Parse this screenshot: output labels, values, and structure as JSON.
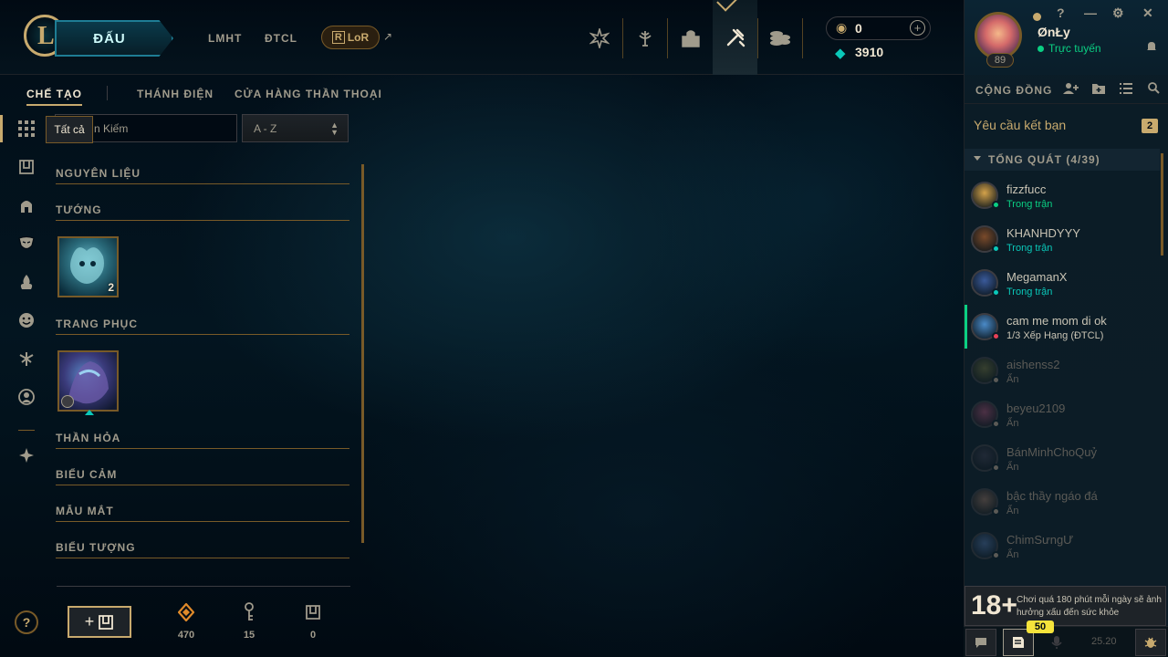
{
  "topnav": {
    "logo_letter": "L",
    "play_label": "ĐẤU",
    "links": [
      "LMHT",
      "ĐTCL"
    ],
    "lor_label": "LoR",
    "lor_arrow": "↗",
    "icons": [
      "clash-icon",
      "trophy-icon",
      "collection-icon",
      "loot-icon",
      "store-icon"
    ],
    "rp_value": "0",
    "rp_plus": "+",
    "be_value": "3910"
  },
  "profile": {
    "name": "ØnŁy",
    "status": "Trực tuyến",
    "level": "89",
    "controls": [
      "?",
      "—",
      "⚙",
      "✕"
    ]
  },
  "social": {
    "title": "CỘNG ĐỒNG",
    "friend_requests_label": "Yêu cầu kết bạn",
    "friend_requests_count": "2",
    "group_label": "TỔNG QUÁT (4/39)",
    "friends": [
      {
        "name": "fizzfucc",
        "status": "Trong trận",
        "status_color": "#0acf83",
        "dot": "#0acf83",
        "avatar": "#d4a24a"
      },
      {
        "name": "KHANHDYYY",
        "status": "Trong trận",
        "status_color": "#0ac8b9",
        "dot": "#0ac8b9",
        "avatar": "#7a4a2a"
      },
      {
        "name": "MegamanX",
        "status": "Trong trận",
        "status_color": "#0ac8b9",
        "dot": "#0ac8b9",
        "avatar": "#3a5a9a"
      },
      {
        "name": "cam me mom di ok",
        "status": "1/3 Xếp Hạng (ĐTCL)",
        "status_color": "#c8c3b4",
        "dot": "#e84057",
        "avatar": "#4a8ac8"
      },
      {
        "name": "aishenss2",
        "status": "Ẩn",
        "status_color": "#5b5a56",
        "dot": "#5b5a56",
        "avatar": "#6a6a3a"
      },
      {
        "name": "beyeu2109",
        "status": "Ẩn",
        "status_color": "#5b5a56",
        "dot": "#5b5a56",
        "avatar": "#9a4a6a"
      },
      {
        "name": "BánMinhChoQuỷ",
        "status": "Ẩn",
        "status_color": "#5b5a56",
        "dot": "#5b5a56",
        "avatar": "#3a3a4a"
      },
      {
        "name": "bậc thầy ngáo đá",
        "status": "Ẩn",
        "status_color": "#5b5a56",
        "dot": "#5b5a56",
        "avatar": "#8a6a5a"
      },
      {
        "name": "ChimSưngƯ",
        "status": "Ẩn",
        "status_color": "#5b5a56",
        "dot": "#5b5a56",
        "avatar": "#4a6a9a"
      }
    ],
    "warning_num": "18+",
    "warning_text": "Chơi quá 180 phút mỗi ngày sẽ ảnh hưởng xấu đến sức khỏe",
    "foot_badge": "50",
    "version": "25.20"
  },
  "subnav": {
    "tabs": [
      "CHẾ TẠO",
      "THÁNH ĐIỆN",
      "CỬA HÀNG THẦN THOẠI"
    ]
  },
  "filter": {
    "tooltip": "Tất cả",
    "search_value": "n Kiếm",
    "sort_value": "A - Z"
  },
  "inventory": {
    "categories": [
      "NGUYÊN LIỆU",
      "TƯỚNG",
      "TRANG PHỤC",
      "THẦN HỎA",
      "BIỂU CẢM",
      "MẪU MẮT",
      "BIỂU TƯỢNG"
    ],
    "champion_count": "2"
  },
  "bottom": {
    "help": "?",
    "craft_label": "+",
    "essence_value": "470",
    "keys_value": "15",
    "chests_value": "0"
  }
}
